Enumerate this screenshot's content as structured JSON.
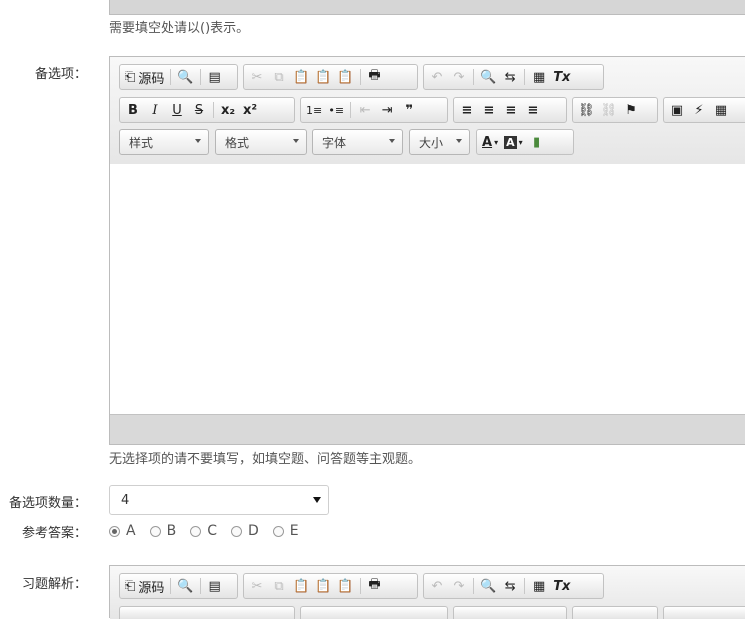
{
  "top_hint": "需要填空处请以()表示。",
  "options_label": "备选项：",
  "analysis_label": "习题解析：",
  "bottom_hint": "无选择项的请不要填写，如填空题、问答题等主观题。",
  "count_label": "备选项数量：",
  "count_value": "4",
  "answer_label": "参考答案：",
  "answers": [
    "A",
    "B",
    "C",
    "D",
    "E"
  ],
  "selected_answer": "A",
  "toolbar": {
    "source_label": "源码",
    "format_style": "样式",
    "format_block": "格式",
    "font": "字体",
    "size": "大小",
    "glyphs": {
      "source": "⎗",
      "preview": "🔍",
      "template": "▤",
      "cut": "✂",
      "copy": "⧉",
      "paste": "📋",
      "paste_text": "📋",
      "paste_word": "📋",
      "print": "🖶",
      "undo": "↶",
      "redo": "↷",
      "find": "🔍",
      "replace": "⇆",
      "select_all": "▦",
      "remove_format": "Tx",
      "bold": "B",
      "italic": "I",
      "underline": "U",
      "strike": "S",
      "subscript": "x₂",
      "superscript": "x²",
      "ol": "1≡",
      "ul": "•≡",
      "outdent": "⇤",
      "indent": "⇥",
      "blockquote": "❞",
      "align_left": "≡",
      "align_center": "≡",
      "align_right": "≡",
      "align_justify": "≡",
      "link": "⛓",
      "unlink": "⛓",
      "anchor": "⚑",
      "image": "▣",
      "flash": "⚡",
      "table": "▦",
      "text_color": "A",
      "bg_color": "A",
      "iframe": "▮"
    }
  }
}
